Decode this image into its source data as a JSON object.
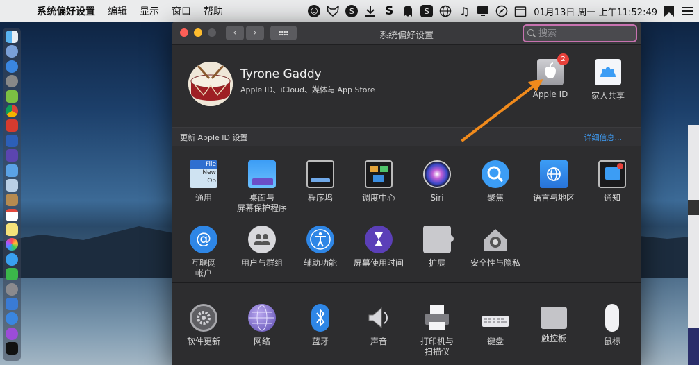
{
  "menubar": {
    "apple_icon": "",
    "items": [
      "系统偏好设置",
      "编辑",
      "显示",
      "窗口",
      "帮助"
    ],
    "status_icons": [
      "smiley-icon",
      "fox-icon",
      "circle-s-icon",
      "download-icon",
      "s-icon",
      "ghost-icon",
      "s-box-icon",
      "globe-icon",
      "music-note-icon",
      "display-icon",
      "compass-icon",
      "calendar-icon"
    ],
    "clock": "01月13日 周一 上午11:52:49"
  },
  "window": {
    "title": "系统偏好设置",
    "search_placeholder": "搜索",
    "nav_back": "‹",
    "nav_forward": "›"
  },
  "profile": {
    "name": "Tyrone Gaddy",
    "subtitle": "Apple ID、iCloud、媒体与 App Store",
    "apple_id_label": "Apple ID",
    "apple_id_badge": "2",
    "family_label": "家人共享",
    "update_text": "更新 Apple ID 设置",
    "more_link": "详细信息..."
  },
  "prefs_row1": [
    "通用",
    "桌面与\n屏幕保护程序",
    "程序坞",
    "调度中心",
    "Siri",
    "聚焦",
    "语言与地区",
    "通知"
  ],
  "prefs_row2": [
    "互联网\n帐户",
    "用户与群组",
    "辅助功能",
    "屏幕使用时间",
    "扩展",
    "安全性与隐私"
  ],
  "prefs_row3": [
    "软件更新",
    "网络",
    "蓝牙",
    "声音",
    "打印机与\n扫描仪",
    "键盘",
    "触控板",
    "鼠标"
  ],
  "general_icon_text": [
    "File",
    "New",
    "Op"
  ],
  "colors": {
    "accent_link": "#3e9cf5",
    "arrow": "#f08a1c",
    "badge": "#e8413b",
    "search_focus": "#c872b0"
  }
}
